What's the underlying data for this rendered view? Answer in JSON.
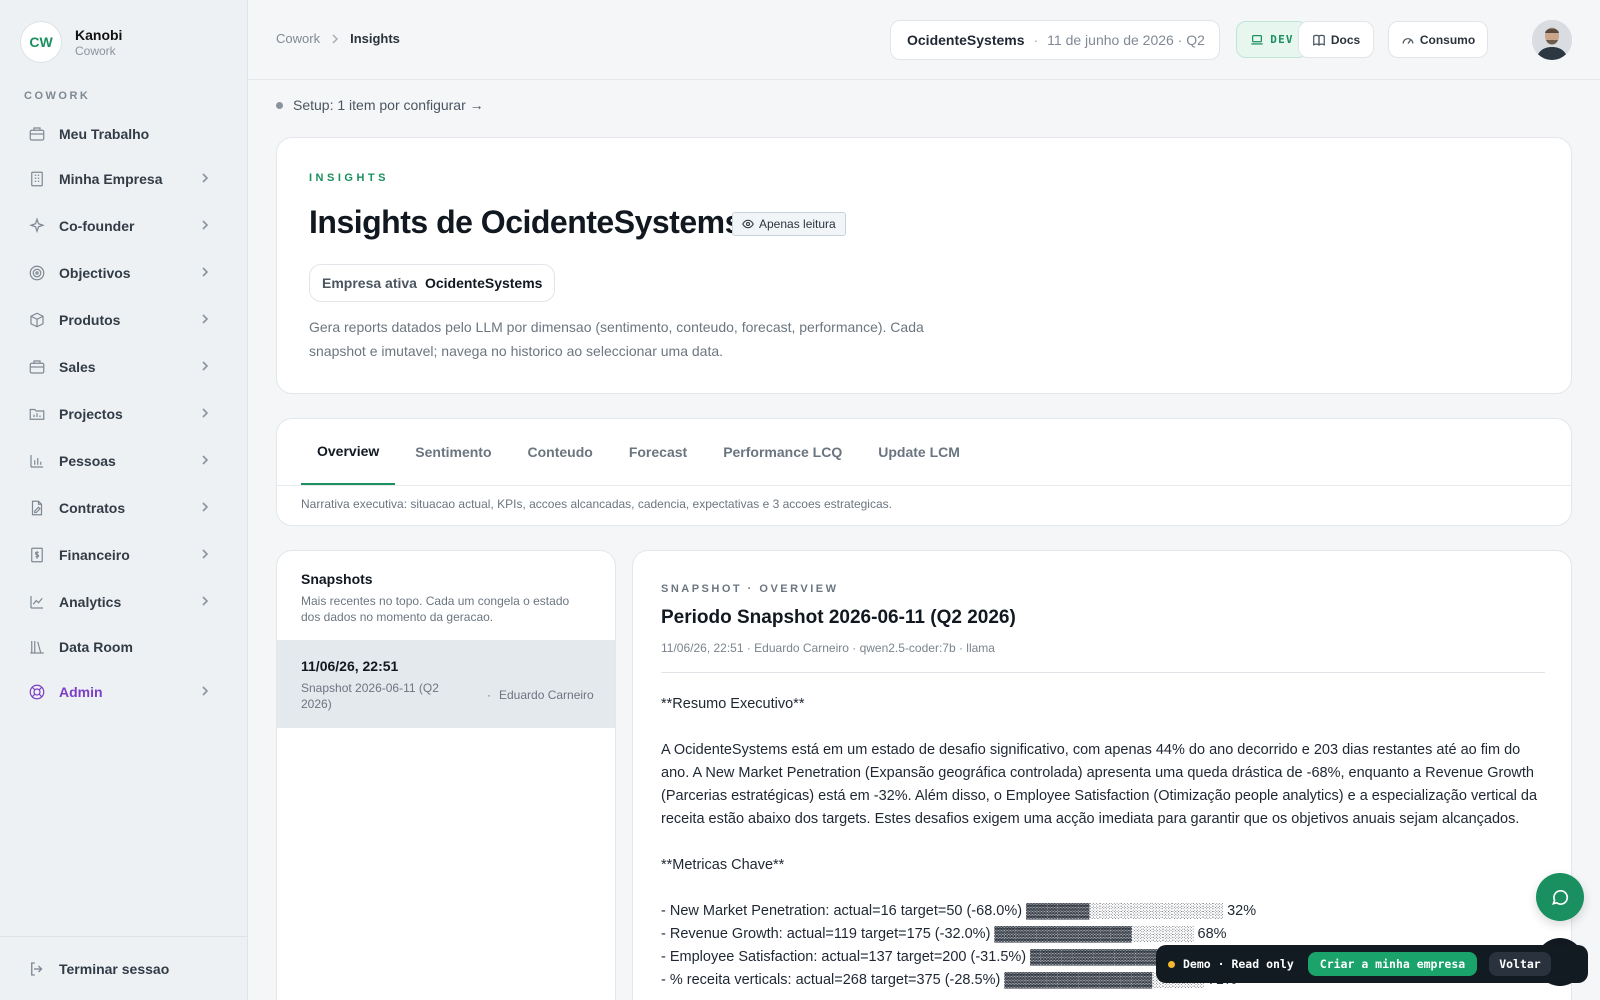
{
  "brand": {
    "logo": "CW",
    "name": "Kanobi",
    "sub": "Cowork"
  },
  "sidebar": {
    "section": "COWORK",
    "items": [
      {
        "label": "Meu Trabalho",
        "icon": "briefcase-icon",
        "chevron": false
      },
      {
        "label": "Minha Empresa",
        "icon": "building-icon",
        "chevron": true
      },
      {
        "label": "Co-founder",
        "icon": "sparkle-icon",
        "chevron": true
      },
      {
        "label": "Objectivos",
        "icon": "target-icon",
        "chevron": true
      },
      {
        "label": "Produtos",
        "icon": "box-icon",
        "chevron": true
      },
      {
        "label": "Sales",
        "icon": "briefcase-icon",
        "chevron": true
      },
      {
        "label": "Projectos",
        "icon": "folder-chart-icon",
        "chevron": true
      },
      {
        "label": "Pessoas",
        "icon": "bar-chart-icon",
        "chevron": true
      },
      {
        "label": "Contratos",
        "icon": "document-edit-icon",
        "chevron": true
      },
      {
        "label": "Financeiro",
        "icon": "dollar-doc-icon",
        "chevron": true
      },
      {
        "label": "Analytics",
        "icon": "line-chart-icon",
        "chevron": true
      },
      {
        "label": "Data Room",
        "icon": "library-icon",
        "chevron": false
      },
      {
        "label": "Admin",
        "icon": "lifebuoy-icon",
        "chevron": true,
        "accent": "#7b3fc6"
      }
    ],
    "logout": "Terminar sessao"
  },
  "topbar": {
    "crumb_root": "Cowork",
    "crumb_current": "Insights",
    "company": "OcidenteSystems",
    "separator": "·",
    "date": "11 de junho de 2026 · Q2",
    "env": "DEV",
    "docs": "Docs",
    "consumo": "Consumo"
  },
  "setup": {
    "text": "Setup: 1 item por configurar →"
  },
  "hero": {
    "eyebrow": "INSIGHTS",
    "title": "Insights de OcidenteSystems",
    "badge": "Apenas leitura",
    "empresa_label": "Empresa ativa",
    "empresa_value": "OcidenteSystems",
    "description": "Gera reports datados pelo LLM por dimensao (sentimento, conteudo, forecast, performance). Cada snapshot e imutavel; navega no historico ao seleccionar uma data."
  },
  "tabs": {
    "items": [
      "Overview",
      "Sentimento",
      "Conteudo",
      "Forecast",
      "Performance LCQ",
      "Update LCM"
    ],
    "active": "Overview",
    "description": "Narrativa executiva: situacao actual, KPIs, accoes alcancadas, cadencia, expectativas e 3 accoes estrategicas."
  },
  "snapshots": {
    "title": "Snapshots",
    "subtitle": "Mais recentes no topo. Cada um congela o estado dos dados no momento da geracao.",
    "items": [
      {
        "date": "11/06/26, 22:51",
        "name": "Snapshot 2026-06-11 (Q2 2026)",
        "separator": "·",
        "author": "Eduardo Carneiro"
      }
    ]
  },
  "detail": {
    "eyebrow": "SNAPSHOT · OVERVIEW",
    "title": "Periodo Snapshot 2026-06-11 (Q2 2026)",
    "meta": "11/06/26, 22:51 · Eduardo Carneiro · qwen2.5-coder:7b · llama",
    "summary_heading": "**Resumo Executivo**",
    "summary": "A OcidenteSystems está em um estado de desafio significativo, com apenas 44% do ano decorrido e 203 dias restantes até ao fim do ano. A New Market Penetration (Expansão geográfica controlada) apresenta uma queda drástica de -68%, enquanto a Revenue Growth (Parcerias estratégicas) está em -32%. Além disso, o Employee Satisfaction (Otimização people analytics) e a especialização vertical da receita estão abaixo dos targets. Estes desafios exigem uma acção imediata para garantir que os objetivos anuais sejam alcançados.",
    "metrics_heading": "**Metricas Chave**",
    "metrics": [
      "- New Market Penetration: actual=16 target=50 (-68.0%) ▓▓▓▓▓▓░░░░░░░░░░░░░ 32%",
      "- Revenue Growth: actual=119 target=175 (-32.0%) ▓▓▓▓▓▓▓▓▓▓▓▓▓░░░░░░ 68%",
      "- Employee Satisfaction: actual=137 target=200 (-31.5%) ▓▓▓▓▓▓▓▓▓▓▓▓▓░░░░░░ 69%",
      "- % receita verticals: actual=268 target=375 (-28.5%) ▓▓▓▓▓▓▓▓▓▓▓▓▓▓░░░░░ 71%"
    ]
  },
  "demo": {
    "status": "Demo · Read only",
    "create": "Criar a minha empresa",
    "back": "Voltar"
  },
  "colors": {
    "accent": "#1a8f5f",
    "admin": "#7b3fc6",
    "demo_dot": "#f5b82e"
  }
}
